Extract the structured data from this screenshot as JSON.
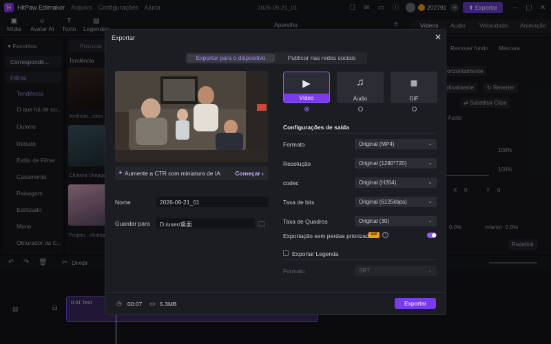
{
  "titlebar": {
    "app_name": "HitPaw Edimakor",
    "menu": [
      "Arquivo",
      "Configurações",
      "Ajuda"
    ],
    "project": "2026-09-21_01",
    "credits": "202791",
    "export_label": "Exportar"
  },
  "toolbar": {
    "tools": [
      {
        "label": "Mídia",
        "icon": "media-icon"
      },
      {
        "label": "Avatar AI",
        "icon": "avatar-icon"
      },
      {
        "label": "Texto",
        "icon": "text-icon"
      },
      {
        "label": "Legendas",
        "icon": "caption-icon"
      }
    ],
    "right_tabs": [
      "Vídeos",
      "Áudio",
      "Velocidade",
      "Animação"
    ],
    "panel_label": "Aparelho"
  },
  "sidebar": {
    "favorites": "Favoritos",
    "corresponding": "Correspondê...",
    "filters": "Filtros",
    "items": [
      "Tendência",
      "O que há de no...",
      "Outono",
      "Retrato",
      "Estilo de Filme",
      "Casamento",
      "Paisagem",
      "Estilizado",
      "Mono",
      "Obturador da C..."
    ]
  },
  "media": {
    "search_placeholder": "Procurar",
    "section": "Tendência",
    "captions": [
      "Amêndo...elios",
      "Câmera Vintage",
      "Projeto...nhattan"
    ]
  },
  "rpanel": {
    "items": [
      "orizontalmente",
      "Remover fundo",
      "Máscara",
      "rticalmente",
      "Reverter",
      "Substituir Clipe",
      "Áudio",
      "100%",
      "100%",
      "X",
      "0",
      "Y",
      "0",
      "0.0%",
      "Inferior",
      "0.0%",
      "Redefinir"
    ]
  },
  "timeline": {
    "split_label": "Dividir",
    "clip_label": "0:01 Text"
  },
  "dialog": {
    "title": "Exportar",
    "tabs": {
      "device": "Exportar para o dispositivo",
      "social": "Publicar nas redes sociais"
    },
    "ctr": {
      "text": "Aumente a CTR com miniatura de IA",
      "action": "Começar"
    },
    "name_label": "Nome",
    "name_value": "2026-09-21_01",
    "save_label": "Guardar para",
    "save_value": "D:/user/桌面",
    "formats": [
      {
        "label": "Vídeo",
        "icon": "film-icon",
        "selected": true
      },
      {
        "label": "Áudio",
        "icon": "music-note-icon",
        "selected": false
      },
      {
        "label": "GIF",
        "icon": "gif-icon",
        "selected": false
      }
    ],
    "output_title": "Configurações de saída",
    "settings": [
      {
        "label": "Formato",
        "value": "Original (MP4)"
      },
      {
        "label": "Resolução",
        "value": "Original (1280*720)"
      },
      {
        "label": "codec",
        "value": "Original (H264)"
      },
      {
        "label": "Taxa de bits",
        "value": "Original (6125kbps)"
      },
      {
        "label": "Taxa de Quadros",
        "value": "Original (30)"
      }
    ],
    "lossless_label": "Exportação sem perdas priorizada",
    "vip": "VIP",
    "subtitle_export": "Exportar Legenda",
    "subtitle_format_label": "Formato",
    "subtitle_format_value": "SRT",
    "duration": "00:07",
    "size": "5.3MB",
    "export_button": "Exportar"
  }
}
